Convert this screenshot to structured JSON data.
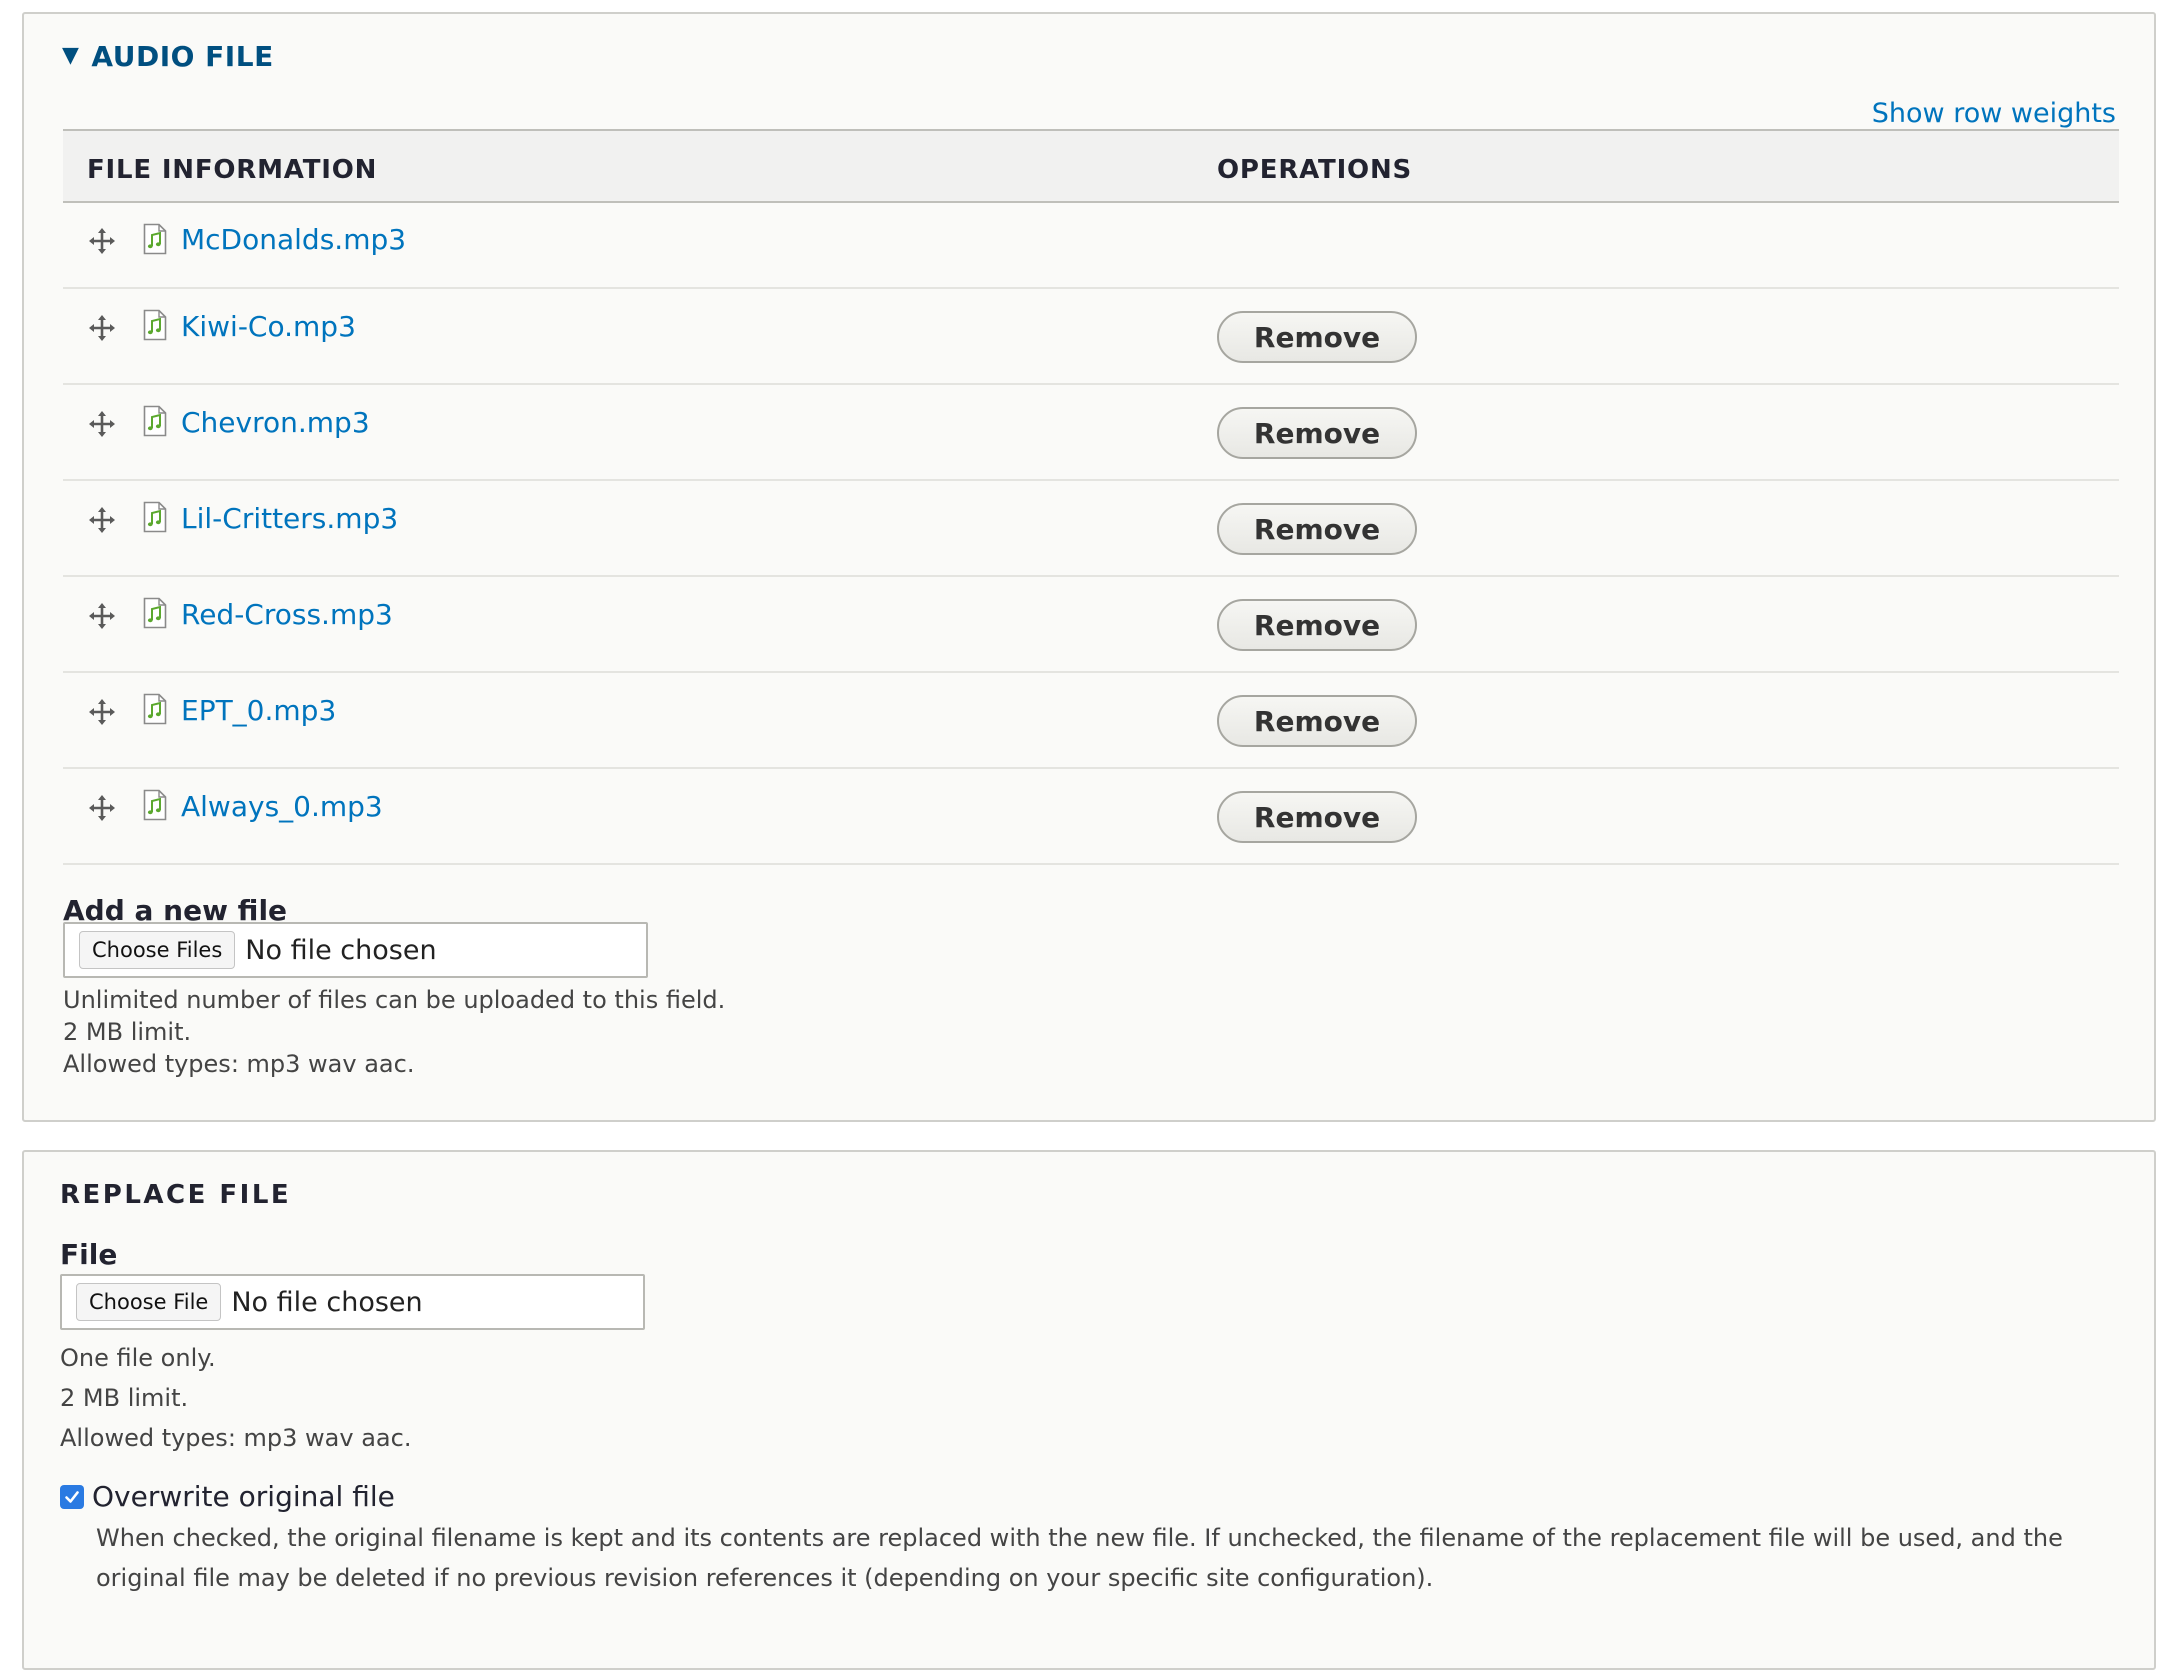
{
  "audio_section": {
    "summary": "AUDIO FILE",
    "show_row_weights": "Show row weights",
    "columns": [
      "FILE INFORMATION",
      "OPERATIONS"
    ],
    "files": [
      {
        "name": "McDonalds.mp3",
        "remove_label": ""
      },
      {
        "name": "Kiwi-Co.mp3",
        "remove_label": "Remove"
      },
      {
        "name": "Chevron.mp3",
        "remove_label": "Remove"
      },
      {
        "name": "Lil-Critters.mp3",
        "remove_label": "Remove"
      },
      {
        "name": "Red-Cross.mp3",
        "remove_label": "Remove"
      },
      {
        "name": "EPT_0.mp3",
        "remove_label": "Remove"
      },
      {
        "name": "Always_0.mp3",
        "remove_label": "Remove"
      }
    ],
    "add_label": "Add a new file",
    "choose_button": "Choose Files",
    "no_file": "No file chosen",
    "help": [
      "Unlimited number of files can be uploaded to this field.",
      "2 MB limit.",
      "Allowed types: mp3 wav aac."
    ]
  },
  "replace_section": {
    "title": "REPLACE FILE",
    "file_label": "File",
    "choose_button": "Choose File",
    "no_file": "No file chosen",
    "help": [
      "One file only.",
      "2 MB limit.",
      "Allowed types: mp3 wav aac."
    ],
    "overwrite_label": "Overwrite original file",
    "overwrite_checked": true,
    "overwrite_description": "When checked, the original filename is kept and its contents are replaced with the new file. If unchecked, the filename of the replacement file will be used, and the original file may be deleted if no previous revision references it (depending on your specific site configuration)."
  },
  "colors": {
    "link": "#0074bd",
    "summary": "#004f80",
    "checkbox": "#2a7ae2",
    "audio_icon": "#5ba82e"
  }
}
